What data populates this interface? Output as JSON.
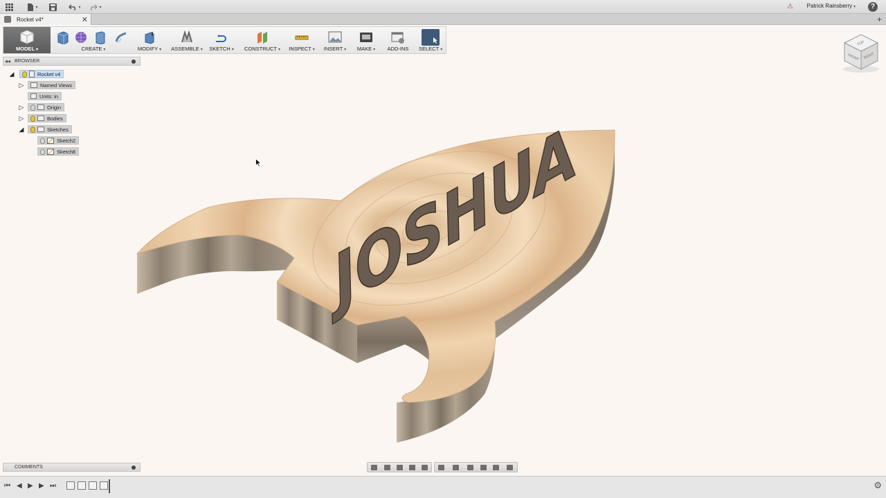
{
  "app": {
    "user_name": "Patrick Rainsberry",
    "help_label": "?",
    "grid_icon": "app-grid-icon"
  },
  "document": {
    "tab_title": "Rocket v4*",
    "close_glyph": "✕",
    "new_tab_glyph": "+"
  },
  "toolbar": {
    "mode": "MODEL",
    "groups": [
      "CREATE",
      "MODIFY",
      "ASSEMBLE",
      "SKETCH",
      "CONSTRUCT",
      "INSPECT",
      "INSERT",
      "MAKE",
      "ADD-INS",
      "SELECT"
    ]
  },
  "browser": {
    "title": "BROWSER",
    "root": "Rocket v4",
    "items": [
      {
        "label": "Named Views"
      },
      {
        "label": "Units: in"
      },
      {
        "label": "Origin"
      },
      {
        "label": "Bodies"
      },
      {
        "label": "Sketches"
      },
      {
        "label": "Sketch2"
      },
      {
        "label": "Sketch8"
      }
    ]
  },
  "canvas": {
    "engraved_text": "JOSHUA"
  },
  "viewcube": {
    "faces": [
      "TOP",
      "FRONT",
      "RIGHT"
    ]
  },
  "comments": {
    "title": "COMMENTS"
  },
  "colors": {
    "accent": "#3e5a78",
    "wood_light": "#e8cba4",
    "wood_side": "#a39584",
    "background": "#fbf6f2"
  }
}
